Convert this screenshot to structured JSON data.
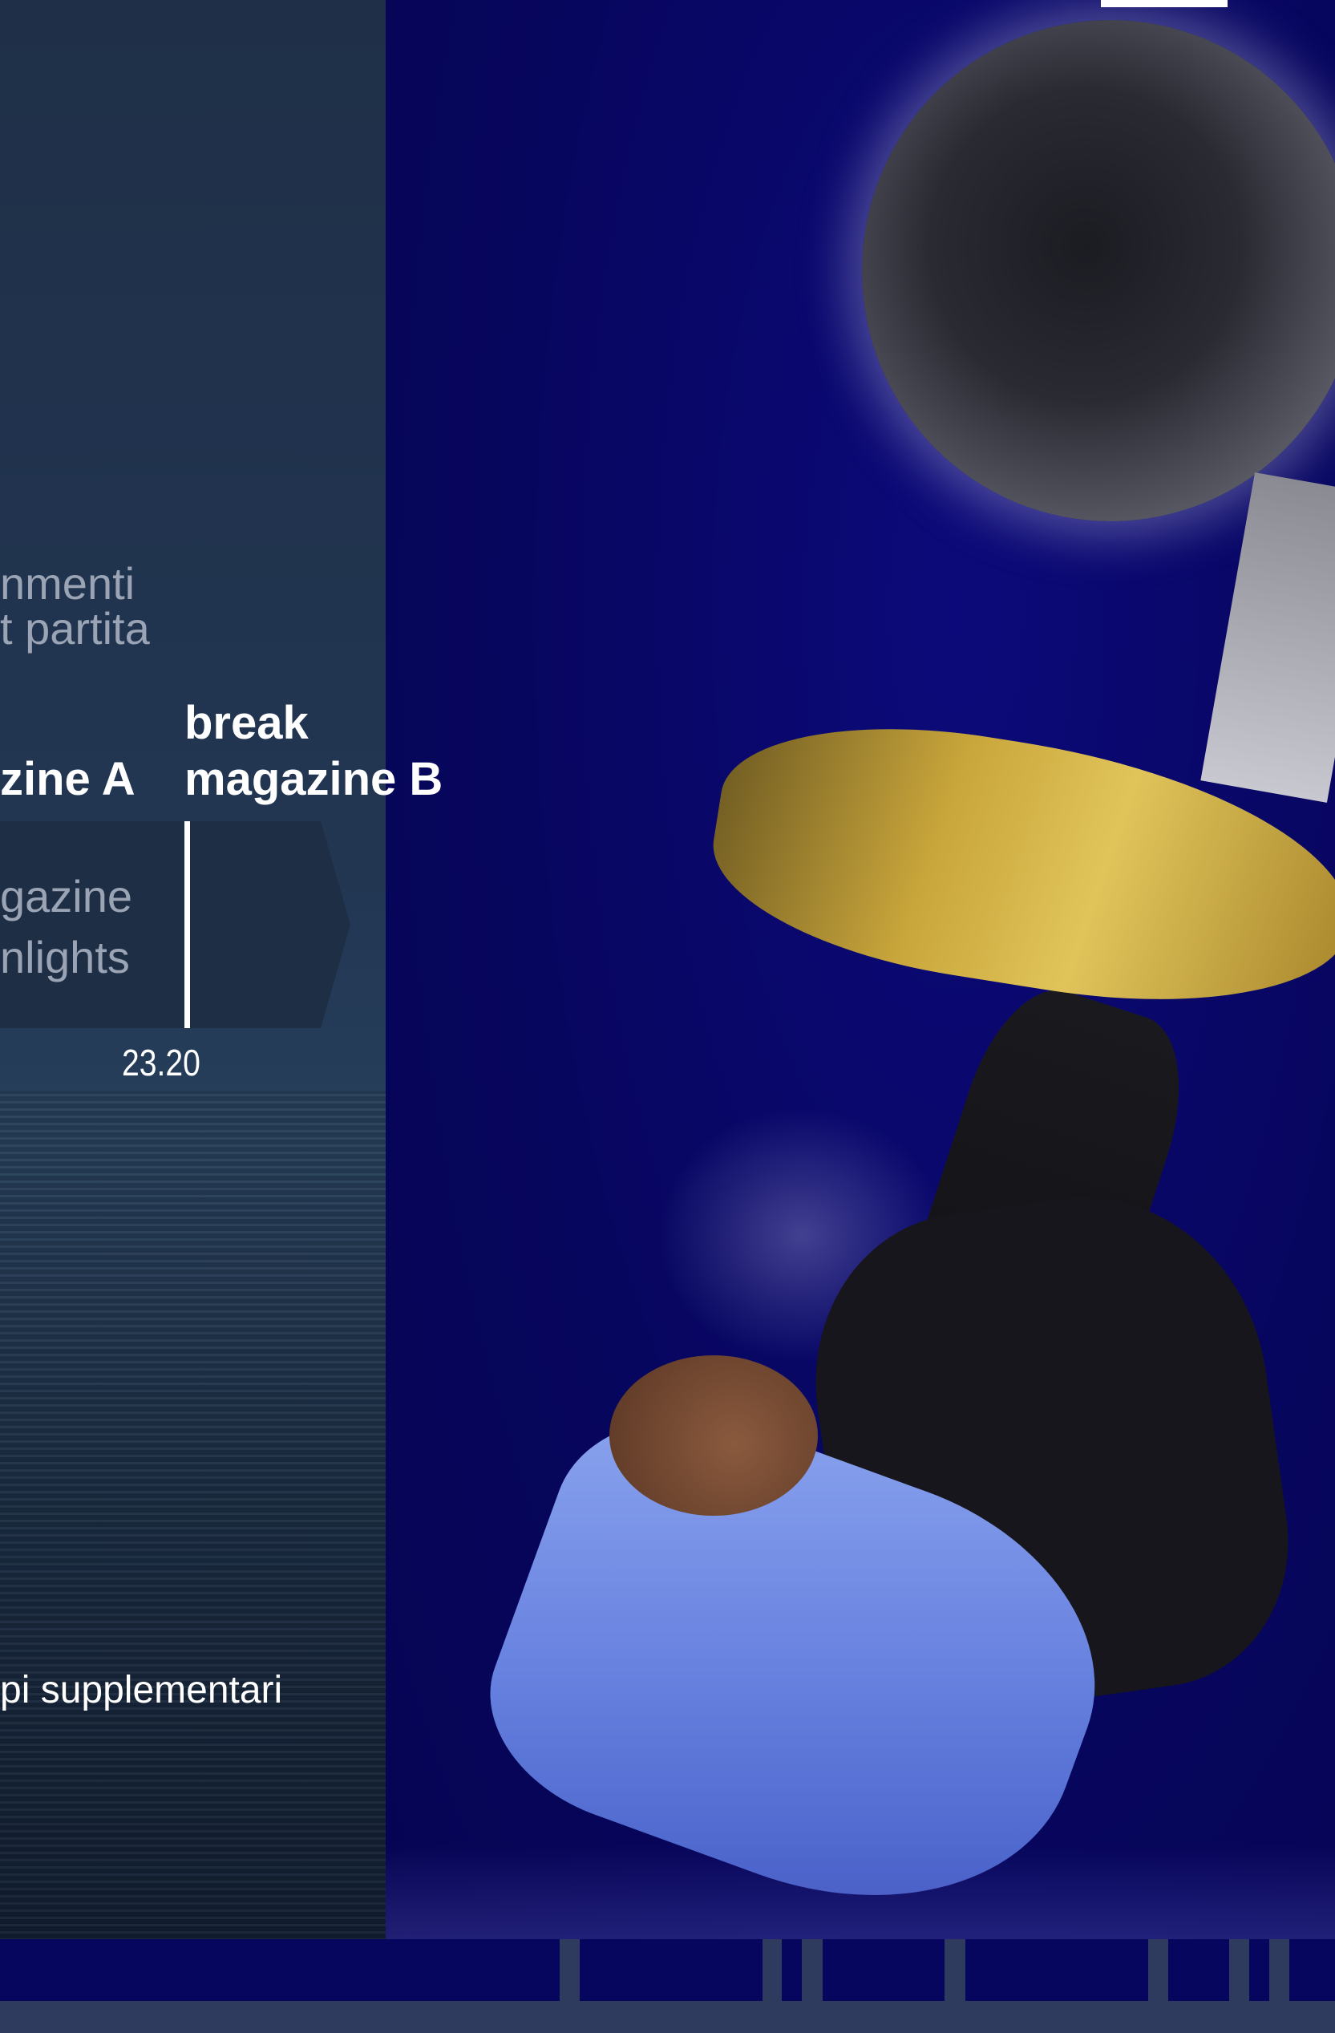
{
  "left_panel": {
    "top_label_line1": "nmenti",
    "top_label_line2": "t partita",
    "column_a_title": "zine A",
    "column_b_title_line1": "break",
    "column_b_title_line2": "magazine B",
    "band_text_line1": "gazine",
    "band_text_line2": "nlights",
    "time": "23.20",
    "extra_label": "pi supplementari"
  },
  "colors": {
    "right_background": "#07065e",
    "left_panel": "#223652",
    "band": "#1e2e45",
    "gray_text": "#9aa4b4",
    "white": "#ffffff"
  },
  "illustration": {
    "subject": "football-player-bicycle-kick"
  }
}
